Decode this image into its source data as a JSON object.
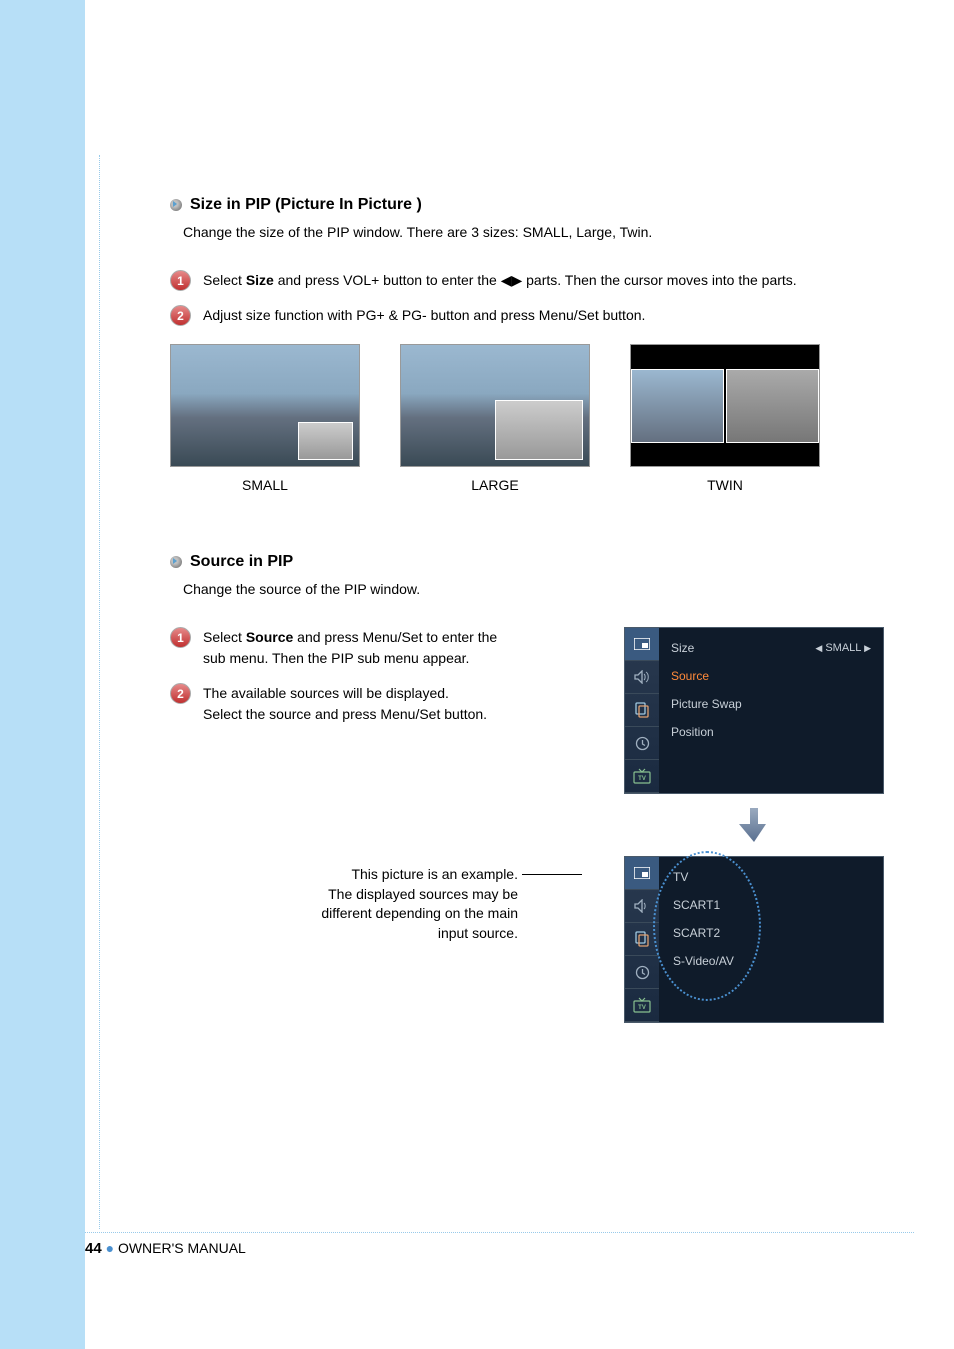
{
  "section1": {
    "title": "Size in PIP (Picture In Picture )",
    "desc": "Change the size of the PIP window. There are 3 sizes: SMALL, Large, Twin.",
    "step1_pre": "Select ",
    "step1_bold": "Size",
    "step1_mid": " and press VOL+ button to enter the ",
    "step1_post": " parts. Then the cursor moves into the parts.",
    "step2": "Adjust size function with PG+ & PG- button and press Menu/Set button.",
    "labels": {
      "small": "SMALL",
      "large": "LARGE",
      "twin": "TWIN"
    }
  },
  "section2": {
    "title": "Source in PIP",
    "desc": "Change the source of the PIP window.",
    "step1_pre": "Select ",
    "step1_bold": "Source",
    "step1_post": " and press Menu/Set to enter the sub menu. Then the PIP sub menu appear.",
    "step2": "The available sources will be displayed.\nSelect the source and press Menu/Set button.",
    "note": "This picture is an example.\nThe displayed sources may be different depending on the main input source."
  },
  "menu1": {
    "rows": [
      {
        "label": "Size",
        "value": "SMALL",
        "selected": false
      },
      {
        "label": "Source",
        "value": "",
        "selected": true
      },
      {
        "label": "Picture Swap",
        "value": "",
        "selected": false
      },
      {
        "label": "Position",
        "value": "",
        "selected": false
      }
    ]
  },
  "menu2": {
    "rows": [
      {
        "label": "TV"
      },
      {
        "label": "SCART1"
      },
      {
        "label": "SCART2"
      },
      {
        "label": "S-Video/AV"
      }
    ]
  },
  "icons": {
    "tv": "TV"
  },
  "footer": {
    "page": "44",
    "label": "OWNER'S MANUAL"
  }
}
